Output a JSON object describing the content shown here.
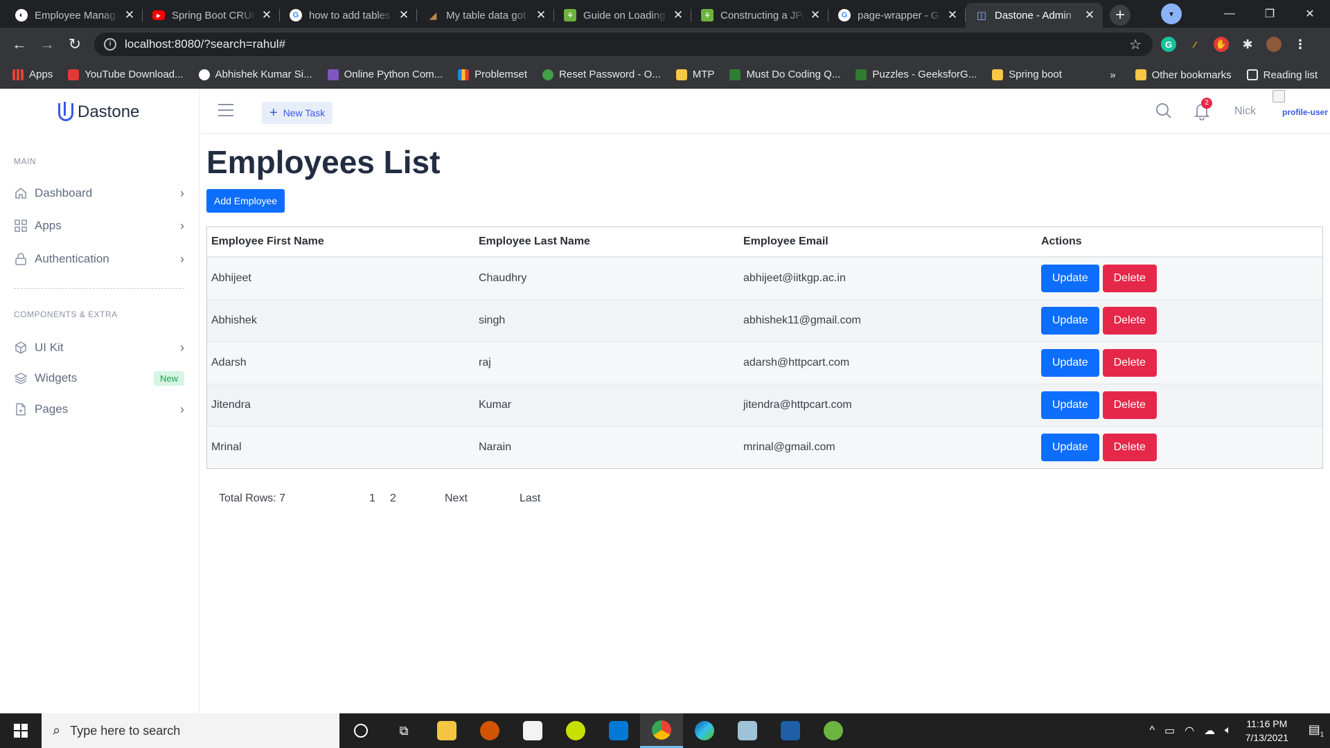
{
  "browser": {
    "tabs": [
      {
        "title": "Employee Manag",
        "favicon_color": "#ffffff",
        "favicon_label": "◐",
        "active": false
      },
      {
        "title": "Spring Boot CRUI",
        "favicon_color": "#ff0000",
        "favicon_label": "▶",
        "active": false
      },
      {
        "title": "how to add tables",
        "favicon_color": "#ffffff",
        "favicon_label": "G",
        "active": false
      },
      {
        "title": "My table data got",
        "favicon_color": "#8b6e4e",
        "favicon_label": "◢",
        "active": false
      },
      {
        "title": "Guide on Loading",
        "favicon_color": "#6db33f",
        "favicon_label": "⚘",
        "active": false
      },
      {
        "title": "Constructing a JPA",
        "favicon_color": "#6db33f",
        "favicon_label": "⚘",
        "active": false
      },
      {
        "title": "page-wrapper - G",
        "favicon_color": "#ffffff",
        "favicon_label": "G",
        "active": false
      },
      {
        "title": "Dastone - Admin",
        "favicon_color": "#3a57e8",
        "favicon_label": "D",
        "active": true
      }
    ],
    "url": "localhost:8080/?search=rahul#",
    "bookmarks": [
      {
        "label": "Apps",
        "color": "#4285f4"
      },
      {
        "label": "YouTube Download...",
        "color": "#e53935"
      },
      {
        "label": "Abhishek Kumar Si...",
        "color": "#ffffff"
      },
      {
        "label": "Online Python Com...",
        "color": "#7e57c2"
      },
      {
        "label": "Problemset",
        "color": "#1e88e5"
      },
      {
        "label": "Reset Password - O...",
        "color": "#43a047"
      },
      {
        "label": "MTP",
        "color": "#f6c744"
      },
      {
        "label": "Must Do Coding Q...",
        "color": "#2e7d32"
      },
      {
        "label": "Puzzles - GeeksforG...",
        "color": "#2e7d32"
      },
      {
        "label": "Spring boot",
        "color": "#f6c744"
      }
    ],
    "bookmarks_overflow": "»",
    "other_bookmarks": "Other bookmarks",
    "reading_list": "Reading list"
  },
  "app": {
    "brand": "Dastone",
    "sidebar": {
      "section_main": "MAIN",
      "section_extra": "COMPONENTS & EXTRA",
      "items": [
        {
          "label": "Dashboard",
          "icon": "home-icon"
        },
        {
          "label": "Apps",
          "icon": "grid-icon"
        },
        {
          "label": "Authentication",
          "icon": "lock-icon"
        },
        {
          "label": "UI Kit",
          "icon": "box-icon"
        },
        {
          "label": "Widgets",
          "icon": "layers-icon",
          "badge": "New"
        },
        {
          "label": "Pages",
          "icon": "file-icon"
        }
      ]
    },
    "topbar": {
      "new_task": "New Task",
      "notification_count": "2",
      "user_name": "Nick",
      "profile_alt": "profile-user"
    },
    "page_title": "Employees List",
    "add_button": "Add Employee",
    "table": {
      "columns": [
        "Employee First Name",
        "Employee Last Name",
        "Employee Email",
        "Actions"
      ],
      "rows": [
        {
          "first": "Abhijeet",
          "last": "Chaudhry",
          "email": "abhijeet@iitkgp.ac.in"
        },
        {
          "first": "Abhishek",
          "last": "singh",
          "email": "abhishek11@gmail.com"
        },
        {
          "first": "Adarsh",
          "last": "raj",
          "email": "adarsh@httpcart.com"
        },
        {
          "first": "Jitendra",
          "last": "Kumar",
          "email": "jitendra@httpcart.com"
        },
        {
          "first": "Mrinal",
          "last": "Narain",
          "email": "mrinal@gmail.com"
        }
      ],
      "update_label": "Update",
      "delete_label": "Delete"
    },
    "pagination": {
      "total": "Total Rows: 7",
      "pages": [
        "1",
        "2"
      ],
      "next": "Next",
      "last": "Last"
    }
  },
  "taskbar": {
    "search_placeholder": "Type here to search",
    "time": "11:16 PM",
    "date": "7/13/2021",
    "notification_count": "1"
  },
  "colors": {
    "primary": "#0d6efd",
    "danger": "#e5284a",
    "brand": "#3a57e8",
    "success_badge": "#1aa053"
  }
}
